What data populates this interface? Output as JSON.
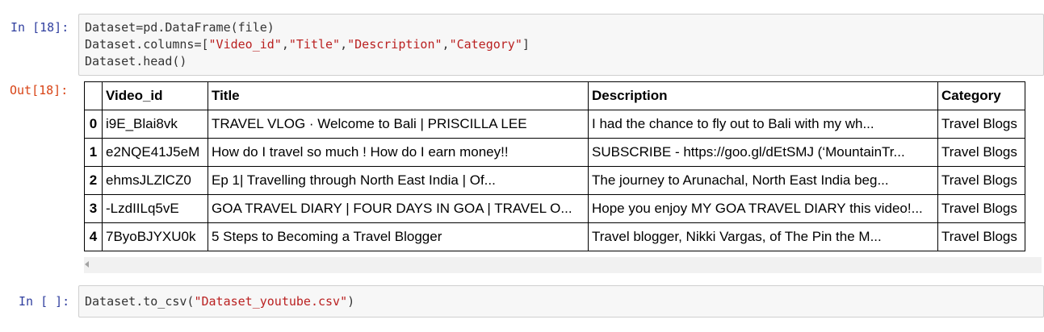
{
  "cell1": {
    "in_prompt": "In [18]:",
    "out_prompt": "Out[18]:",
    "code": {
      "line1": "Dataset=pd.DataFrame(file)",
      "line2_pre": "Dataset.columns=[",
      "s1": "\"Video_id\"",
      "c1": ",",
      "s2": "\"Title\"",
      "c2": ",",
      "s3": "\"Description\"",
      "c3": ",",
      "s4": "\"Category\"",
      "line2_post": "]",
      "line3": "Dataset.head()"
    },
    "table": {
      "columns": [
        "",
        "Video_id",
        "Title",
        "Description",
        "Category"
      ],
      "rows": [
        {
          "index": "0",
          "video_id": "i9E_Blai8vk",
          "title": "TRAVEL VLOG · Welcome to Bali | PRISCILLA LEE",
          "description": "I had the chance to fly out to Bali with my wh...",
          "category": "Travel Blogs"
        },
        {
          "index": "1",
          "video_id": "e2NQE41J5eM",
          "title": "How do I travel so much ! How do I earn money!!",
          "description": "SUBSCRIBE - https://goo.gl/dEtSMJ (‘MountainTr...",
          "category": "Travel Blogs"
        },
        {
          "index": "2",
          "video_id": "ehmsJLZlCZ0",
          "title": "Ep 1| Travelling through North East India | Of...",
          "description": "The journey to Arunachal, North East India beg...",
          "category": "Travel Blogs"
        },
        {
          "index": "3",
          "video_id": "-LzdIILq5vE",
          "title": "GOA TRAVEL DIARY | FOUR DAYS IN GOA | TRAVEL O...",
          "description": "Hope you enjoy MY GOA TRAVEL DIARY this video!...",
          "category": "Travel Blogs"
        },
        {
          "index": "4",
          "video_id": "7ByoBJYXU0k",
          "title": "5 Steps to Becoming a Travel Blogger",
          "description": "Travel blogger, Nikki Vargas, of The Pin the M...",
          "category": "Travel Blogs"
        }
      ]
    }
  },
  "cell2": {
    "in_prompt": "In [ ]:",
    "code": {
      "pre": "Dataset.to_csv(",
      "str": "\"Dataset_youtube.csv\"",
      "post": ")"
    }
  }
}
